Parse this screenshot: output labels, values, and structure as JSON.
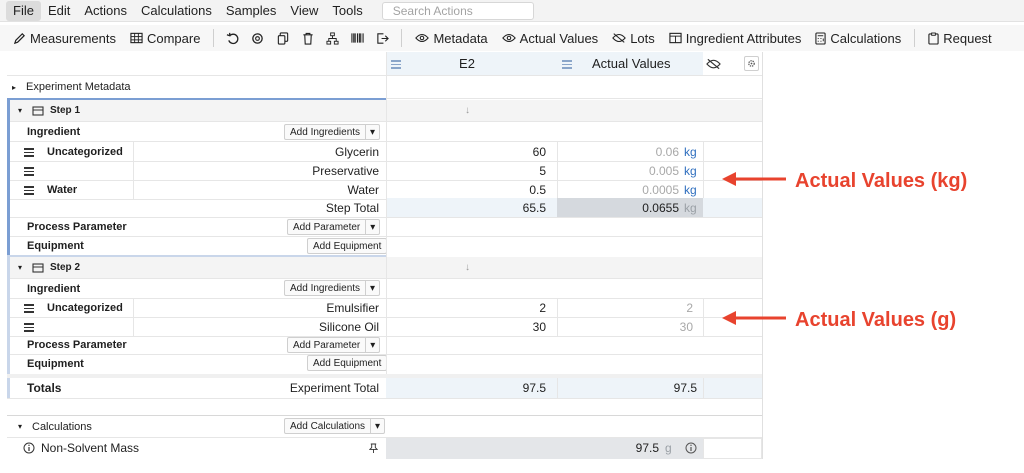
{
  "menu": {
    "items": [
      "File",
      "Edit",
      "Actions",
      "Calculations",
      "Samples",
      "View",
      "Tools"
    ],
    "search_placeholder": "Search Actions"
  },
  "toolbar": {
    "measurements": "Measurements",
    "compare": "Compare",
    "metadata": "Metadata",
    "actual_values": "Actual Values",
    "lots": "Lots",
    "ingredient_attributes": "Ingredient Attributes",
    "calculations": "Calculations",
    "request": "Request"
  },
  "columns": {
    "e2": "E2",
    "actual": "Actual Values"
  },
  "metadata_label": "Experiment Metadata",
  "step1": {
    "title": "Step 1",
    "ingredient_label": "Ingredient",
    "add_ingredients": "Add Ingredients",
    "rows": [
      {
        "category": "Uncategorized",
        "name": "Glycerin",
        "value": "60",
        "actual": "0.06",
        "unit": "kg"
      },
      {
        "category": "",
        "name": "Preservative",
        "value": "5",
        "actual": "0.005",
        "unit": "kg"
      },
      {
        "category": "Water",
        "name": "Water",
        "value": "0.5",
        "actual": "0.0005",
        "unit": "kg"
      }
    ],
    "total_label": "Step Total",
    "total_value": "65.5",
    "total_actual": "0.0655",
    "total_unit": "kg",
    "process_label": "Process Parameter",
    "add_parameter": "Add Parameter",
    "equipment_label": "Equipment",
    "add_equipment": "Add Equipment"
  },
  "step2": {
    "title": "Step 2",
    "ingredient_label": "Ingredient",
    "add_ingredients": "Add Ingredients",
    "rows": [
      {
        "category": "Uncategorized",
        "name": "Emulsifier",
        "value": "2",
        "actual": "2"
      },
      {
        "category": "",
        "name": "Silicone Oil",
        "value": "30",
        "actual": "30"
      }
    ],
    "process_label": "Process Parameter",
    "add_parameter": "Add Parameter",
    "equipment_label": "Equipment",
    "add_equipment": "Add Equipment"
  },
  "totals": {
    "label": "Totals",
    "experiment_total_label": "Experiment Total",
    "value": "97.5",
    "actual": "97.5"
  },
  "calculations": {
    "label": "Calculations",
    "add_calculations": "Add Calculations",
    "row_name": "Non-Solvent Mass",
    "value": "97.5",
    "unit": "g"
  },
  "annotations": {
    "kg": "Actual Values (kg)",
    "g": "Actual Values (g)"
  },
  "colors": {
    "accent_red": "#e8432e",
    "unit_blue": "#2f6fbf",
    "step_bar_blue": "#7b9ed3"
  }
}
